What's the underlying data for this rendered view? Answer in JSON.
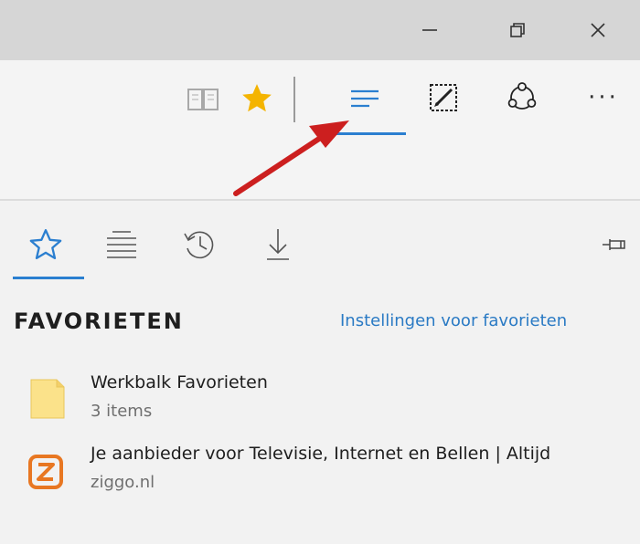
{
  "window_controls": {
    "minimize": "minimize-icon",
    "restore": "restore-icon",
    "close": "close-icon"
  },
  "toolbar": {
    "buttons": [
      {
        "id": "reading-view",
        "icon": "book-icon"
      },
      {
        "id": "add-favorite",
        "icon": "star-icon",
        "color": "#f4b400"
      },
      {
        "id": "hub",
        "icon": "hub-lines-icon",
        "active": true,
        "color": "#2b7fd0"
      },
      {
        "id": "web-note",
        "icon": "web-note-icon"
      },
      {
        "id": "share",
        "icon": "share-icon"
      },
      {
        "id": "more",
        "icon": "more-icon",
        "label": "···"
      }
    ]
  },
  "annotation": {
    "arrow_color": "#cc1f1f"
  },
  "hub": {
    "tabs": [
      {
        "id": "favorites",
        "icon": "star-outline-icon",
        "active": true
      },
      {
        "id": "reading-list",
        "icon": "reading-list-icon"
      },
      {
        "id": "history",
        "icon": "history-icon"
      },
      {
        "id": "downloads",
        "icon": "download-icon"
      }
    ],
    "pin_icon": "pin-icon",
    "section_title": "FAVORIETEN",
    "settings_link": "Instellingen voor favorieten",
    "items": [
      {
        "title": "Werkbalk Favorieten",
        "subtitle": "3 items",
        "icon": "folder-icon"
      },
      {
        "title": "Je aanbieder voor Televisie, Internet en Bellen | Altijd",
        "subtitle": "ziggo.nl",
        "icon": "ziggo-favicon"
      }
    ]
  },
  "colors": {
    "accent": "#2b7fd0",
    "link": "#2a7ac4",
    "folder": "#fbe28a",
    "ziggo_orange": "#e87722"
  }
}
